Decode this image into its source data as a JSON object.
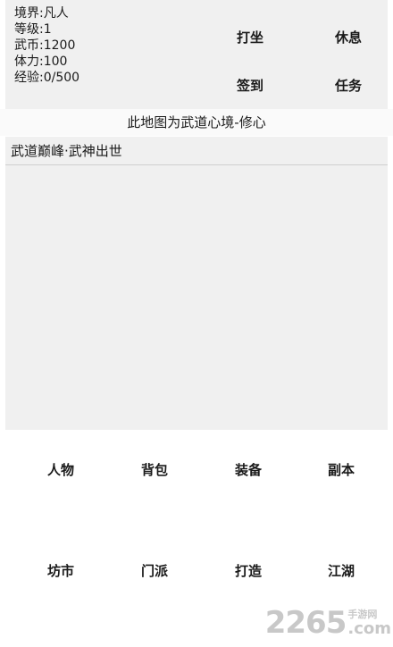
{
  "status": {
    "lines": [
      "境界:凡人",
      "等级:1",
      "武币:1200",
      "体力:100",
      "经验:0/500"
    ],
    "actions": [
      "打坐",
      "休息",
      "签到",
      "任务"
    ]
  },
  "map": {
    "text": "此地图为武道心境-修心"
  },
  "log": {
    "title": "武道巅峰·武神出世"
  },
  "menu": {
    "items": [
      "人物",
      "背包",
      "装备",
      "副本",
      "坊市",
      "门派",
      "打造",
      "江湖"
    ]
  },
  "watermark": {
    "number": "2265",
    "cn": "手游网",
    "com": ".com"
  }
}
